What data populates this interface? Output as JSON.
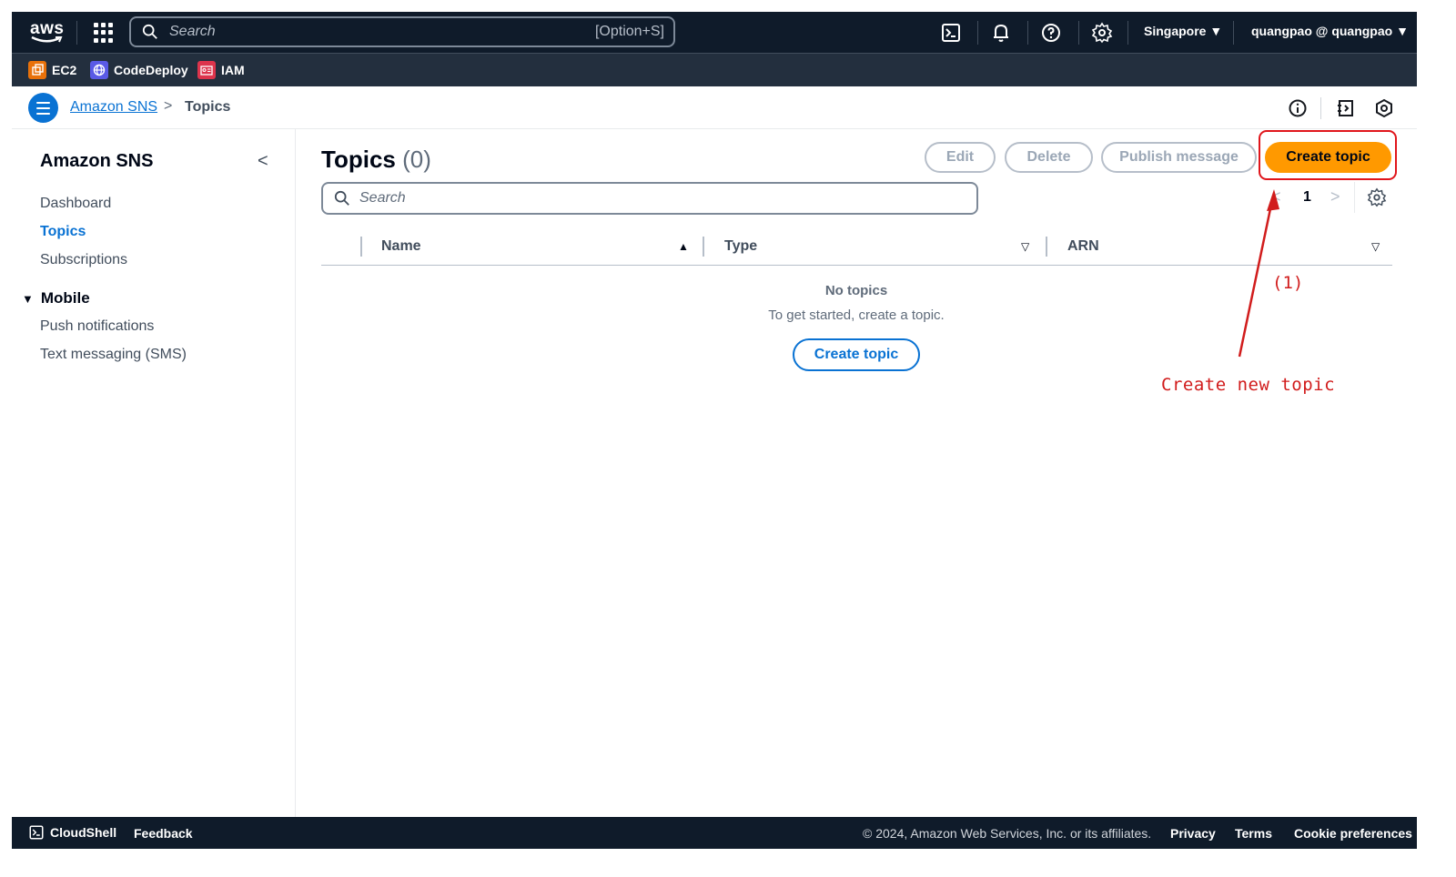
{
  "topnav": {
    "logo_text": "aws",
    "search_placeholder": "Search",
    "search_shortcut": "[Option+S]",
    "region": "Singapore ▼",
    "account": "quangpao @ quangpao ▼"
  },
  "favorites": [
    {
      "label": "EC2",
      "icon": "ec2-icon",
      "color": "#e8710a"
    },
    {
      "label": "CodeDeploy",
      "icon": "codedeploy-icon",
      "color": "#5a5ae6"
    },
    {
      "label": "IAM",
      "icon": "iam-icon",
      "color": "#dd344c"
    }
  ],
  "breadcrumb": {
    "parent": "Amazon SNS",
    "separator": ">",
    "current": "Topics"
  },
  "sidenav": {
    "title": "Amazon SNS",
    "collapse": "<",
    "items": [
      "Dashboard",
      "Topics",
      "Subscriptions"
    ],
    "active_item": "Topics",
    "section": {
      "label": "Mobile",
      "caret": "▼",
      "items": [
        "Push notifications",
        "Text messaging (SMS)"
      ]
    }
  },
  "main": {
    "title": "Topics",
    "count": "(0)",
    "buttons": {
      "edit": "Edit",
      "delete": "Delete",
      "publish": "Publish message",
      "create": "Create topic"
    },
    "search_placeholder": "Search",
    "pager": {
      "prev": "<",
      "page": "1",
      "next": ">"
    },
    "columns": [
      "Name",
      "Type",
      "ARN"
    ],
    "sort_asc": "▲",
    "sort_desc": "▽",
    "empty": {
      "title": "No topics",
      "text": "To get started, create a topic.",
      "button": "Create topic"
    }
  },
  "annotation": {
    "number": "(1)",
    "text": "Create new topic",
    "color": "#d11c1c"
  },
  "footer": {
    "cloudshell": "CloudShell",
    "feedback": "Feedback",
    "copyright": "© 2024, Amazon Web Services, Inc. or its affiliates.",
    "links": [
      "Privacy",
      "Terms",
      "Cookie preferences"
    ]
  },
  "colors": {
    "primary": "#ff9900",
    "link": "#0972d3",
    "nav_bg": "#0f1b2a",
    "fav_bg": "#232f3e"
  }
}
